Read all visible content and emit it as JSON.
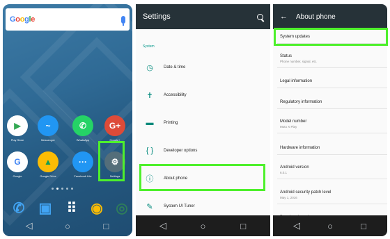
{
  "home": {
    "search_logo": [
      "G",
      "o",
      "o",
      "g",
      "l",
      "e"
    ],
    "apps_row1": [
      {
        "label": "Play Store",
        "color": "#ffffff",
        "glyph": "▶",
        "fg": "#34a853"
      },
      {
        "label": "Messenger",
        "color": "#2196f3",
        "glyph": "~",
        "fg": "#ffffff"
      },
      {
        "label": "WhatsApp",
        "color": "#25d366",
        "glyph": "✆",
        "fg": "#ffffff"
      },
      {
        "label": "Google+",
        "color": "#dd4b39",
        "glyph": "G+",
        "fg": "#ffffff"
      }
    ],
    "apps_row2": [
      {
        "label": "Google",
        "color": "#ffffff",
        "glyph": "G",
        "fg": "#4285f4"
      },
      {
        "label": "Google Drive",
        "color": "#fbbc05",
        "glyph": "▲",
        "fg": "#0f9d58"
      },
      {
        "label": "Facebook Lite",
        "color": "#2196f3",
        "glyph": "···",
        "fg": "#ffffff"
      },
      {
        "label": "Settings",
        "color": "#546e7a",
        "glyph": "⚙",
        "fg": "#ffffff"
      }
    ],
    "dock": [
      {
        "label": "Phone",
        "glyph": "✆",
        "color": "#42a5f5"
      },
      {
        "label": "Contacts",
        "glyph": "▣",
        "color": "#42a5f5"
      },
      {
        "label": "Apps",
        "glyph": "⠿",
        "color": "#ffffff"
      },
      {
        "label": "Chrome",
        "glyph": "◉",
        "color": "#fbbc05"
      },
      {
        "label": "Camera",
        "glyph": "◎",
        "color": "#2e7d5b"
      }
    ],
    "nav": [
      "◁",
      "○",
      "□"
    ]
  },
  "settings": {
    "title": "Settings",
    "section": "System",
    "items": [
      {
        "label": "Date & time",
        "icon": "clock-icon",
        "glyph": "◷"
      },
      {
        "label": "Accessibility",
        "icon": "accessibility-icon",
        "glyph": "✝"
      },
      {
        "label": "Printing",
        "icon": "printer-icon",
        "glyph": "▬"
      },
      {
        "label": "Developer options",
        "icon": "code-icon",
        "glyph": "{ }"
      },
      {
        "label": "About phone",
        "icon": "info-icon",
        "glyph": "ⓘ"
      },
      {
        "label": "System UI Tuner",
        "icon": "wrench-icon",
        "glyph": "✎"
      }
    ]
  },
  "about": {
    "title": "About phone",
    "items": [
      {
        "title": "System updates",
        "sub": ""
      },
      {
        "title": "Status",
        "sub": "Phone number, signal, etc."
      },
      {
        "title": "Legal information",
        "sub": ""
      },
      {
        "title": "Regulatory information",
        "sub": ""
      },
      {
        "title": "Model number",
        "sub": "Moto X Play"
      },
      {
        "title": "Hardware information",
        "sub": ""
      },
      {
        "title": "Android version",
        "sub": "6.0.1"
      },
      {
        "title": "Android security patch level",
        "sub": "May 1, 2016"
      },
      {
        "title": "Baseband version",
        "sub": ""
      }
    ]
  }
}
